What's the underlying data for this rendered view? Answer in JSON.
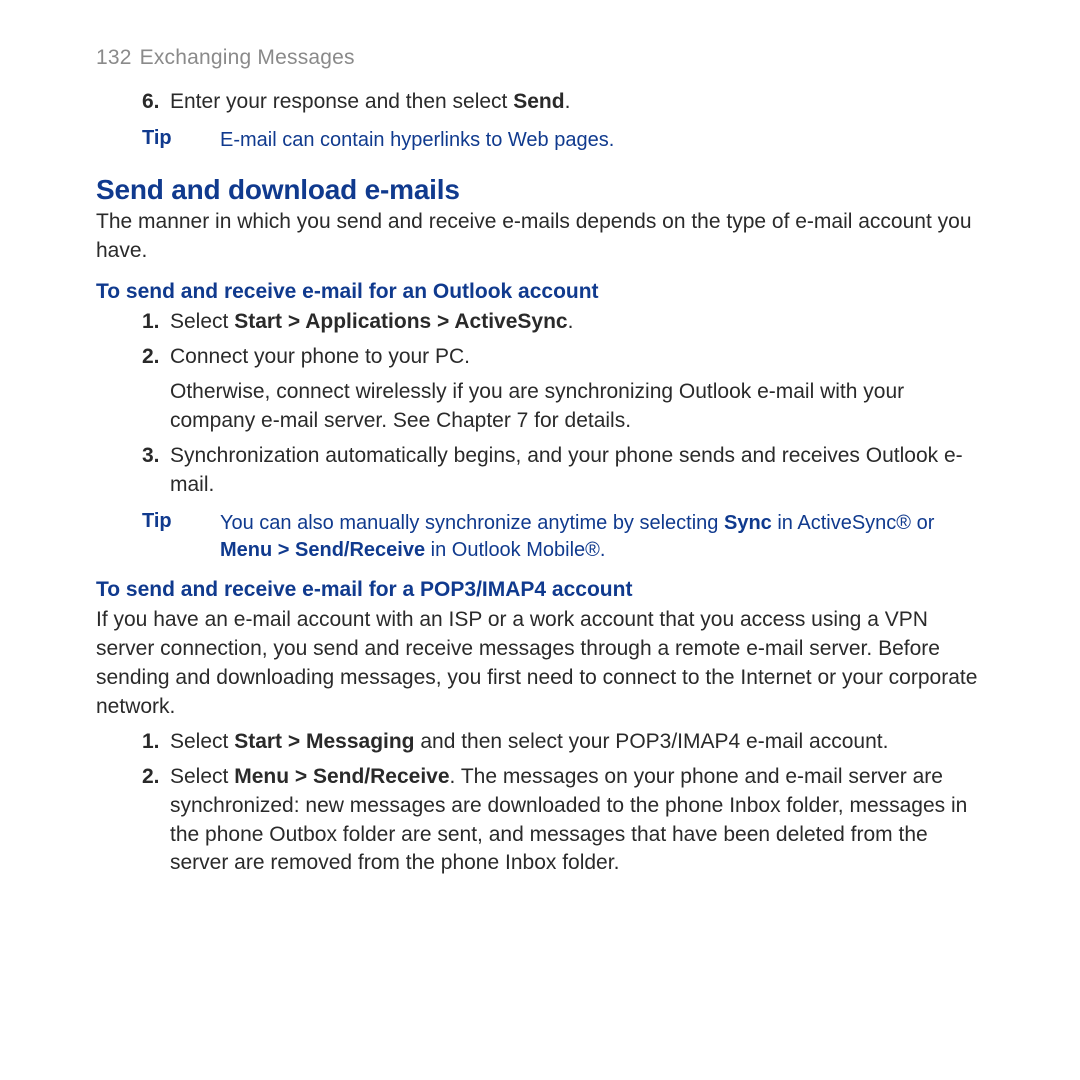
{
  "page": {
    "number": "132",
    "chapter": "Exchanging Messages"
  },
  "topList": {
    "items": [
      {
        "marker": "6.",
        "prefix": "Enter your response and then select ",
        "bold": "Send",
        "suffix": "."
      }
    ]
  },
  "tip1": {
    "label": "Tip",
    "text": "E-mail can contain hyperlinks to Web pages."
  },
  "section": {
    "title": "Send and download e-mails",
    "intro": "The manner in which you send and receive e-mails depends on the type of e-mail account you have."
  },
  "outlook": {
    "heading": "To send and receive e-mail for an Outlook account",
    "items": [
      {
        "marker": "1.",
        "plain_before": "Select ",
        "bold": "Start > Applications > ActiveSync",
        "plain_after": "."
      },
      {
        "marker": "2.",
        "line": "Connect your phone to your PC.",
        "cont": "Otherwise, connect wirelessly if you are synchronizing Outlook e-mail with your company e-mail server. See Chapter 7 for details."
      },
      {
        "marker": "3.",
        "line": "Synchronization automatically begins, and your phone sends and receives Outlook e-mail."
      }
    ]
  },
  "tip2": {
    "label": "Tip",
    "pre": "You can also manually synchronize anytime by selecting ",
    "b1": "Sync",
    "mid": " in ActiveSync® or ",
    "b2": "Menu > Send/Receive",
    "post": " in Outlook Mobile®."
  },
  "pop3": {
    "heading": "To send and receive e-mail for a POP3/IMAP4 account",
    "intro": "If you have an e-mail account with an ISP or a work account that you access using a VPN server connection, you send and receive messages through a remote e-mail server. Before sending and downloading messages, you first need to connect to the Internet or your corporate network.",
    "items": [
      {
        "marker": "1.",
        "pre": "Select ",
        "b1": "Start > Messaging",
        "post": " and then select your POP3/IMAP4 e-mail account."
      },
      {
        "marker": "2.",
        "pre": "Select ",
        "b1": "Menu > Send/Receive",
        "post": ". The messages on your phone and e-mail server are synchronized: new messages are downloaded to the phone Inbox folder, messages in the phone Outbox folder are sent, and messages that have been deleted from the server are removed from the phone Inbox folder."
      }
    ]
  }
}
